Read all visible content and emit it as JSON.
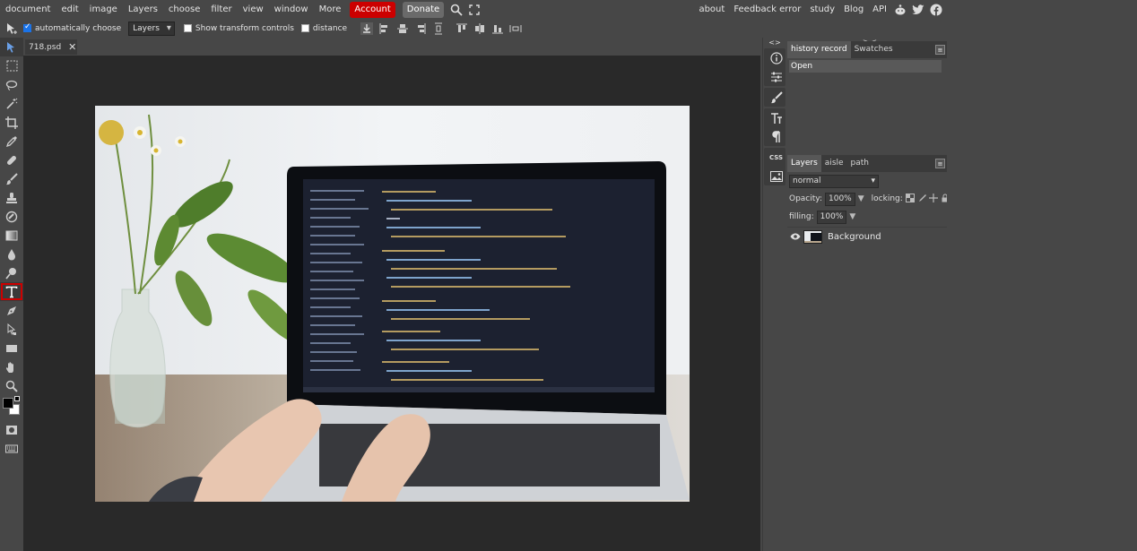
{
  "menu": {
    "items": [
      "document",
      "edit",
      "image",
      "Layers",
      "choose",
      "filter",
      "view",
      "window",
      "More"
    ],
    "account_label": "Account",
    "donate_label": "Donate",
    "right_items": [
      "about",
      "Feedback error",
      "study",
      "Blog",
      "API"
    ]
  },
  "options": {
    "auto_choose_label": "automatically choose",
    "auto_choose_checked": true,
    "target_value": "Layers",
    "show_transform_label": "Show transform controls",
    "show_transform_checked": false,
    "distance_label": "distance",
    "distance_checked": false
  },
  "document": {
    "tab_name": "718.psd",
    "close_glyph": "✕"
  },
  "history_panel": {
    "tabs": [
      "history record",
      "Swatches"
    ],
    "entries": [
      "Open"
    ]
  },
  "layers_panel": {
    "tabs": [
      "Layers",
      "aisle",
      "path"
    ],
    "blend_mode": "normal",
    "opacity_label": "Opacity:",
    "opacity_value": "100%",
    "locking_label": "locking:",
    "fill_label": "filling:",
    "fill_value": "100%",
    "layers": [
      {
        "name": "Background",
        "visible": true
      }
    ]
  },
  "strip": {
    "css_label": "CSS",
    "expand_glyph": "<>",
    "collapse_glyph": "> <"
  },
  "colors": {
    "accent": "#cc0000",
    "panel_bg": "#474747",
    "workspace_bg": "#292929",
    "foreground_color": "#000000",
    "background_color": "#ffffff"
  }
}
